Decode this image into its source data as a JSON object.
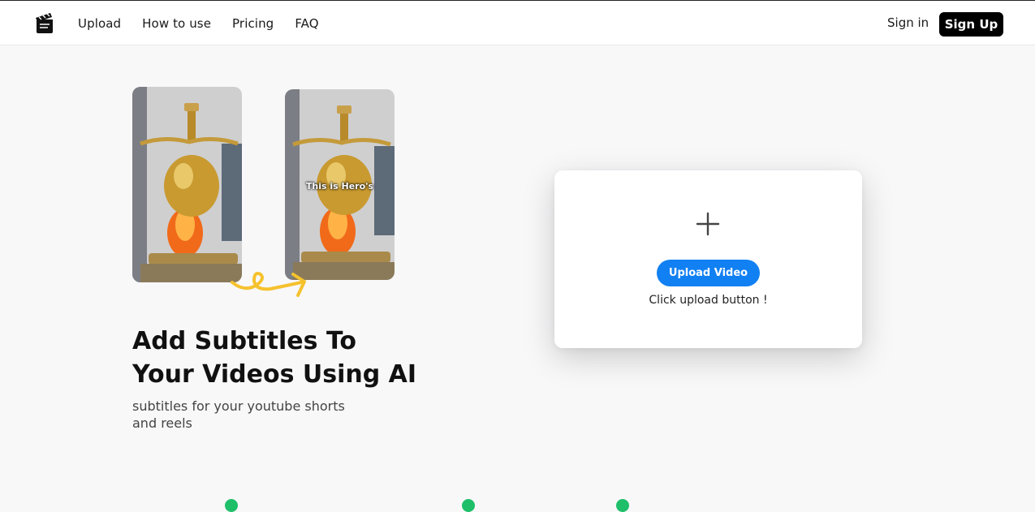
{
  "nav": {
    "logo_icon": "clapperboard-icon",
    "links": [
      "Upload",
      "How to use",
      "Pricing",
      "FAQ"
    ],
    "sign_in": "Sign in",
    "sign_up": "Sign Up"
  },
  "hero": {
    "preview_caption": "This is Hero's",
    "title": "Add Subtitles To Your Videos Using AI",
    "subtitle": "subtitles for your youtube shorts and reels"
  },
  "upload_card": {
    "plus_icon": "plus-icon",
    "button_label": "Upload Video",
    "hint": "Click upload button !"
  },
  "colors": {
    "accent": "#1180f2",
    "signup_bg": "#000000",
    "arrow": "#f5c22e",
    "feature_dot": "#1fbf6a"
  }
}
